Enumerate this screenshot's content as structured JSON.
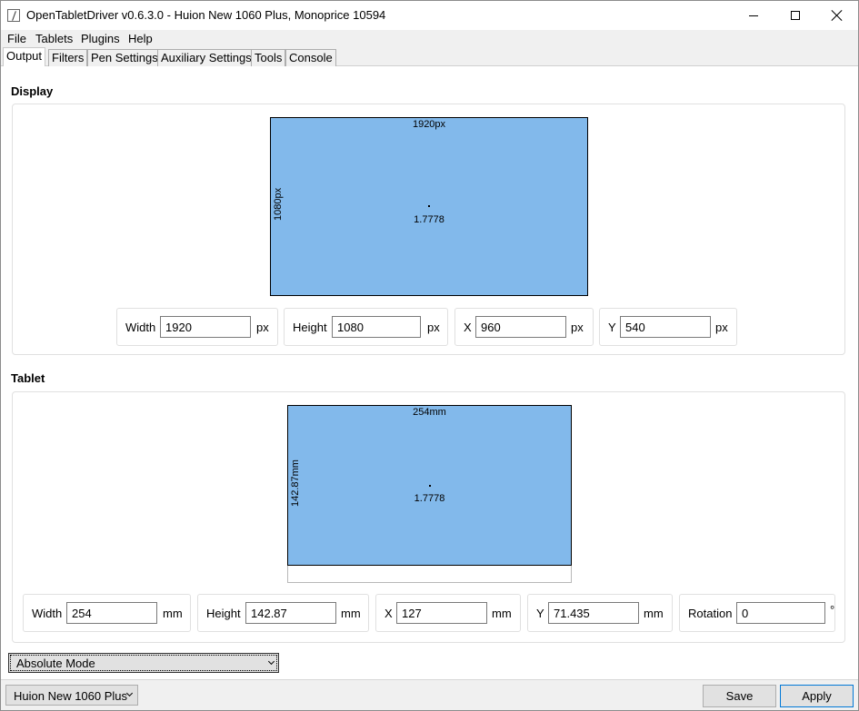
{
  "window": {
    "title": "OpenTabletDriver v0.6.3.0 - Huion New 1060 Plus, Monoprice 10594"
  },
  "menu": [
    "File",
    "Tablets",
    "Plugins",
    "Help"
  ],
  "tabs": [
    {
      "label": "Output",
      "active": true
    },
    {
      "label": "Filters",
      "active": false
    },
    {
      "label": "Pen Settings",
      "active": false
    },
    {
      "label": "Auxiliary Settings",
      "active": false
    },
    {
      "label": "Tools",
      "active": false
    },
    {
      "label": "Console",
      "active": false
    }
  ],
  "display": {
    "section_title": "Display",
    "area_width_label": "1920px",
    "area_height_label": "1080px",
    "ratio": "1.7778",
    "fields": [
      {
        "label": "Width",
        "value": "1920",
        "unit": "px"
      },
      {
        "label": "Height",
        "value": "1080",
        "unit": "px"
      },
      {
        "label": "X",
        "value": "960",
        "unit": "px"
      },
      {
        "label": "Y",
        "value": "540",
        "unit": "px"
      }
    ]
  },
  "tablet": {
    "section_title": "Tablet",
    "area_width_label": "254mm",
    "area_height_label": "142.87mm",
    "ratio": "1.7778",
    "fields": [
      {
        "label": "Width",
        "value": "254",
        "unit": "mm"
      },
      {
        "label": "Height",
        "value": "142.87",
        "unit": "mm"
      },
      {
        "label": "X",
        "value": "127",
        "unit": "mm"
      },
      {
        "label": "Y",
        "value": "71.435",
        "unit": "mm"
      },
      {
        "label": "Rotation",
        "value": "0",
        "unit": "°"
      }
    ]
  },
  "mode": {
    "selected": "Absolute Mode"
  },
  "footer": {
    "tablet_selected": "Huion New 1060 Plus",
    "save_label": "Save",
    "apply_label": "Apply"
  },
  "colors": {
    "area_fill": "#82b9eb",
    "primary_button_border": "#0078d7"
  }
}
